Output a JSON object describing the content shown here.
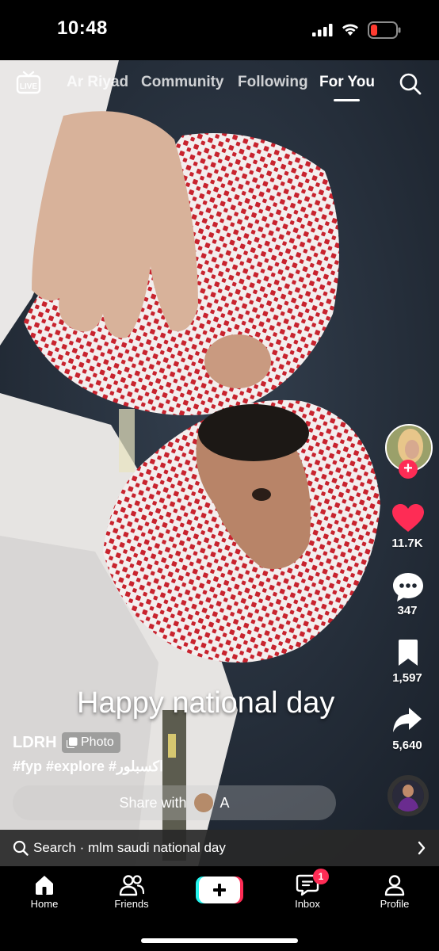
{
  "status_bar": {
    "time": "10:48"
  },
  "top_nav": {
    "live_label": "LIVE",
    "tabs": [
      {
        "label": "Ar Riyad",
        "active": false
      },
      {
        "label": "Community",
        "active": false
      },
      {
        "label": "Following",
        "active": false
      },
      {
        "label": "For You",
        "active": true
      }
    ]
  },
  "video": {
    "overlay_text": "Happy national day",
    "author": "LDRH",
    "post_type_badge": "Photo",
    "caption": "#fyp #explore #اكسبلور",
    "share_prompt": "Share with",
    "share_target": "A"
  },
  "actions": {
    "likes": "11.7K",
    "comments": "347",
    "saves": "1,597",
    "shares": "5,640"
  },
  "search_suggestion": {
    "prefix": "Search",
    "separator": "·",
    "query": "mlm saudi national day"
  },
  "bottom_nav": {
    "items": [
      {
        "label": "Home",
        "icon": "home-icon"
      },
      {
        "label": "Friends",
        "icon": "friends-icon"
      },
      {
        "label": "",
        "icon": "create-icon"
      },
      {
        "label": "Inbox",
        "icon": "inbox-icon",
        "badge": "1"
      },
      {
        "label": "Profile",
        "icon": "profile-icon"
      }
    ]
  },
  "colors": {
    "accent": "#fe2c55",
    "like": "#fe2c55",
    "background": "#000000"
  }
}
